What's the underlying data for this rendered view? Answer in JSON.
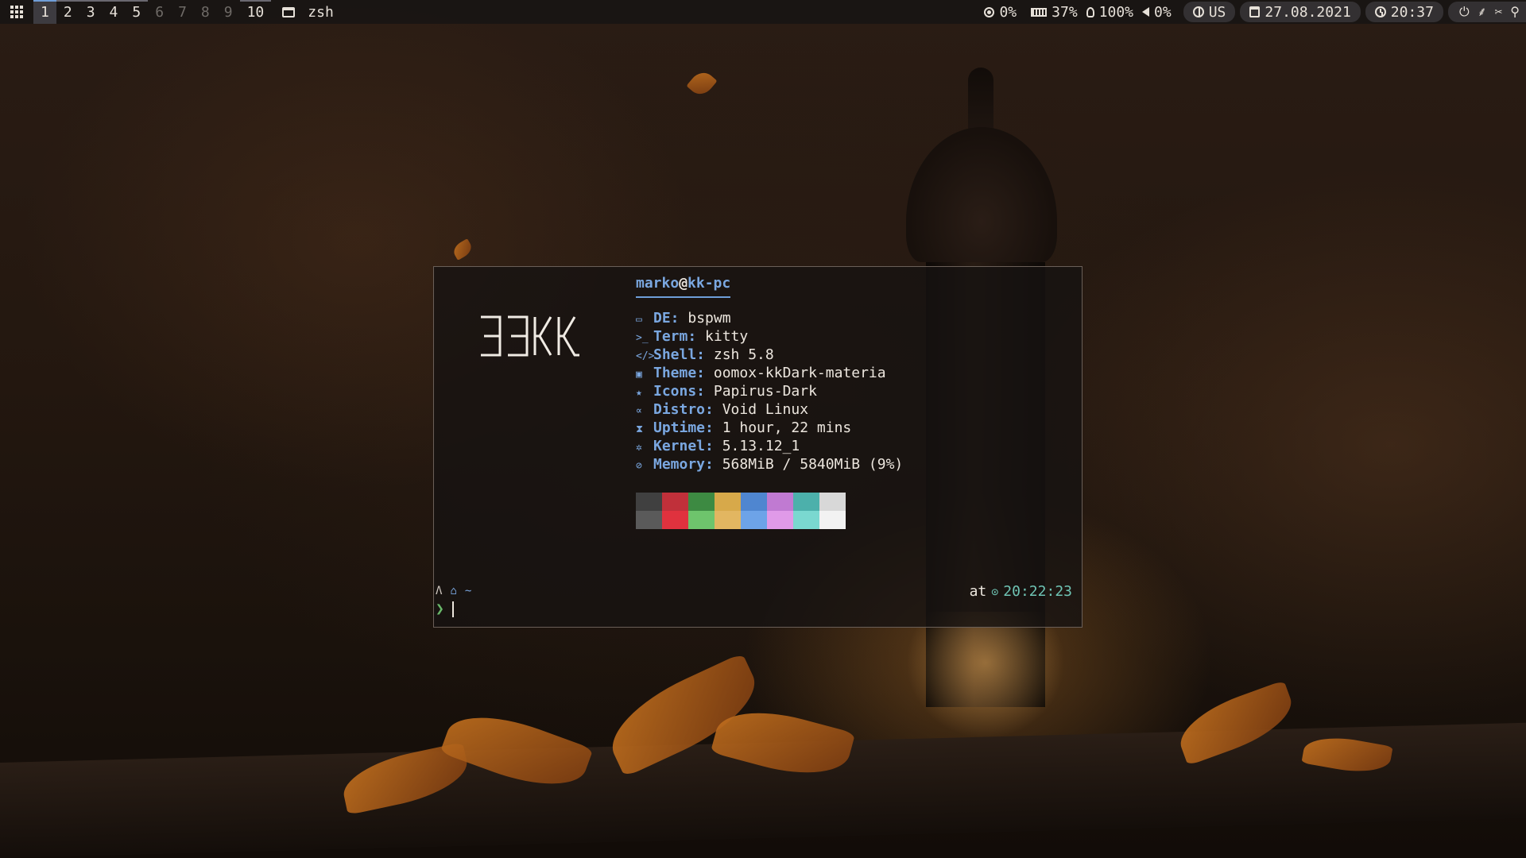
{
  "topbar": {
    "workspaces": [
      {
        "label": "1",
        "state": "active"
      },
      {
        "label": "2",
        "state": "occupied"
      },
      {
        "label": "3",
        "state": "occupied"
      },
      {
        "label": "4",
        "state": "occupied"
      },
      {
        "label": "5",
        "state": "occupied"
      },
      {
        "label": "6",
        "state": "empty"
      },
      {
        "label": "7",
        "state": "empty"
      },
      {
        "label": "8",
        "state": "empty"
      },
      {
        "label": "9",
        "state": "empty"
      },
      {
        "label": "10",
        "state": "occupied"
      }
    ],
    "window_title": "zsh",
    "cpu": "0%",
    "ram": "37%",
    "brightness": "100%",
    "volume": "0%",
    "keyboard_layout": "US",
    "date": "27.08.2021",
    "time": "20:37",
    "accent_color": "#6f9ed8"
  },
  "terminal": {
    "user": "marko",
    "at": "@",
    "host": "kk-pc",
    "logo_text": "ƎƎKK",
    "info": [
      {
        "icon": "monitor-icon",
        "glyph": "▭",
        "key": "DE:",
        "value": " bspwm"
      },
      {
        "icon": "terminal-icon",
        "glyph": ">_",
        "key": "Term:",
        "value": " kitty"
      },
      {
        "icon": "code-icon",
        "glyph": "</>",
        "key": "Shell:",
        "value": " zsh 5.8"
      },
      {
        "icon": "image-icon",
        "glyph": "▣",
        "key": "Theme:",
        "value": " oomox-kkDark-materia"
      },
      {
        "icon": "star-icon",
        "glyph": "★",
        "key": "Icons:",
        "value": " Papirus-Dark"
      },
      {
        "icon": "distro-icon",
        "glyph": "∝",
        "key": "Distro:",
        "value": " Void Linux"
      },
      {
        "icon": "hourglass-icon",
        "glyph": "⧗",
        "key": "Uptime:",
        "value": " 1 hour, 22 mins"
      },
      {
        "icon": "gear-icon",
        "glyph": "✲",
        "key": "Kernel:",
        "value": " 5.13.12_1"
      },
      {
        "icon": "memory-icon",
        "glyph": "⊘",
        "key": "Memory:",
        "value": " 568MiB / 5840MiB (9%)"
      }
    ],
    "palette_top": [
      "#404040",
      "#c0303a",
      "#3d8a42",
      "#d7a94a",
      "#4f86d0",
      "#c07ad2",
      "#4cb0ab",
      "#d8d8d8"
    ],
    "palette_bottom": [
      "#5a5a5a",
      "#e0323e",
      "#6ec46c",
      "#e2b661",
      "#6da3e8",
      "#e09ae8",
      "#7ad8d0",
      "#f2f2f2"
    ],
    "prompt": {
      "os_glyph": "Λ",
      "home_glyph": "⌂",
      "path": "~"
    },
    "time_prefix": "at",
    "time_value": "20:22:23",
    "cmd_glyph": "❯"
  }
}
